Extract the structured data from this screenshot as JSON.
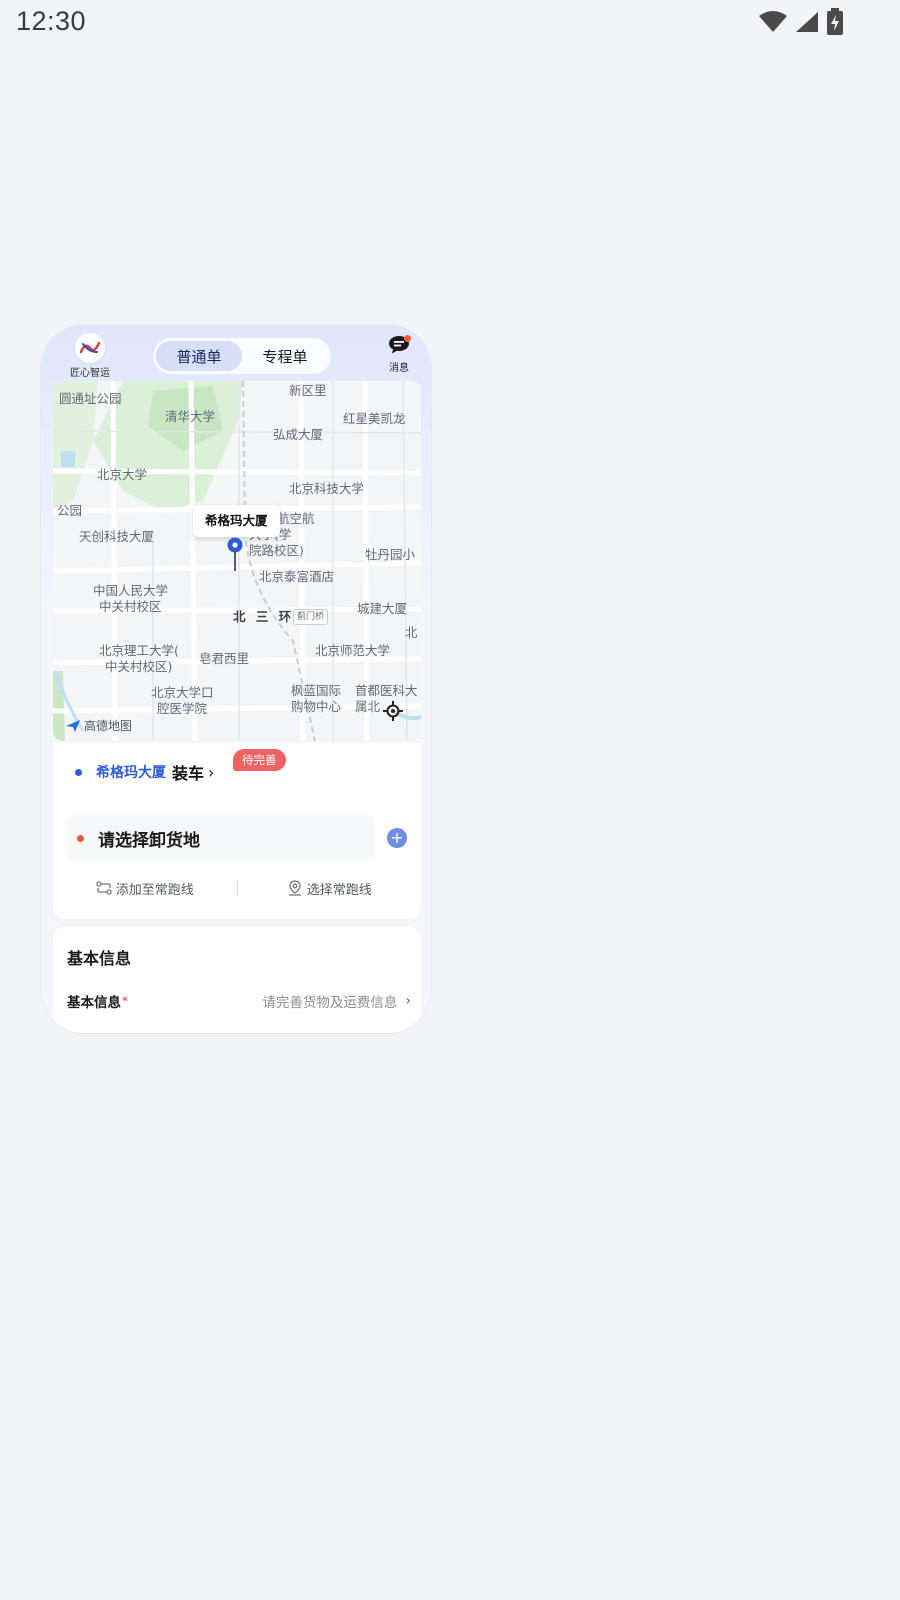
{
  "status_bar": {
    "time": "12:30",
    "icons": [
      "wifi-icon",
      "signal-icon",
      "battery-charging-icon"
    ]
  },
  "header": {
    "logo_text": "匠心智运",
    "tabs": [
      {
        "label": "普通单",
        "active": true
      },
      {
        "label": "专程单",
        "active": false
      }
    ],
    "message_label": "消息"
  },
  "map": {
    "callout": "希格玛大厦",
    "attribution": "高德地图",
    "labels": [
      "圆通址公园",
      "清华大学",
      "弘成大厦",
      "红星美凯龙",
      "北京大学",
      "北京科技大学",
      "公园",
      "天创科技大厦",
      "航空航",
      "大学(学",
      "院路校区)",
      "牡丹园小",
      "北京泰富酒店",
      "中国人民大学",
      "中关村校区",
      "北 三 环",
      "蓟门桥",
      "城建大厦",
      "北",
      "北京理工大学(",
      "中关村校区)",
      "皂君西里",
      "北京师范大学",
      "北京大学口",
      "腔医学院",
      "枫蓝国际",
      "购物中心",
      "首都医科大",
      "属北",
      "新区里"
    ]
  },
  "route": {
    "load_name": "希格玛大厦",
    "load_action": "装车",
    "load_chevron": "›",
    "status_badge": "待完善",
    "unload_placeholder": "请选择卸货地",
    "add_button": "+",
    "add_route": "添加至常跑线",
    "choose_route": "选择常跑线"
  },
  "basic_info": {
    "title": "基本信息",
    "label": "基本信息",
    "required": "*",
    "value": "请完善货物及运费信息",
    "chevron": "›"
  },
  "colors": {
    "accent": "#2f5bd8",
    "badge": "#ef6262",
    "unload_dot": "#e15a3a"
  }
}
